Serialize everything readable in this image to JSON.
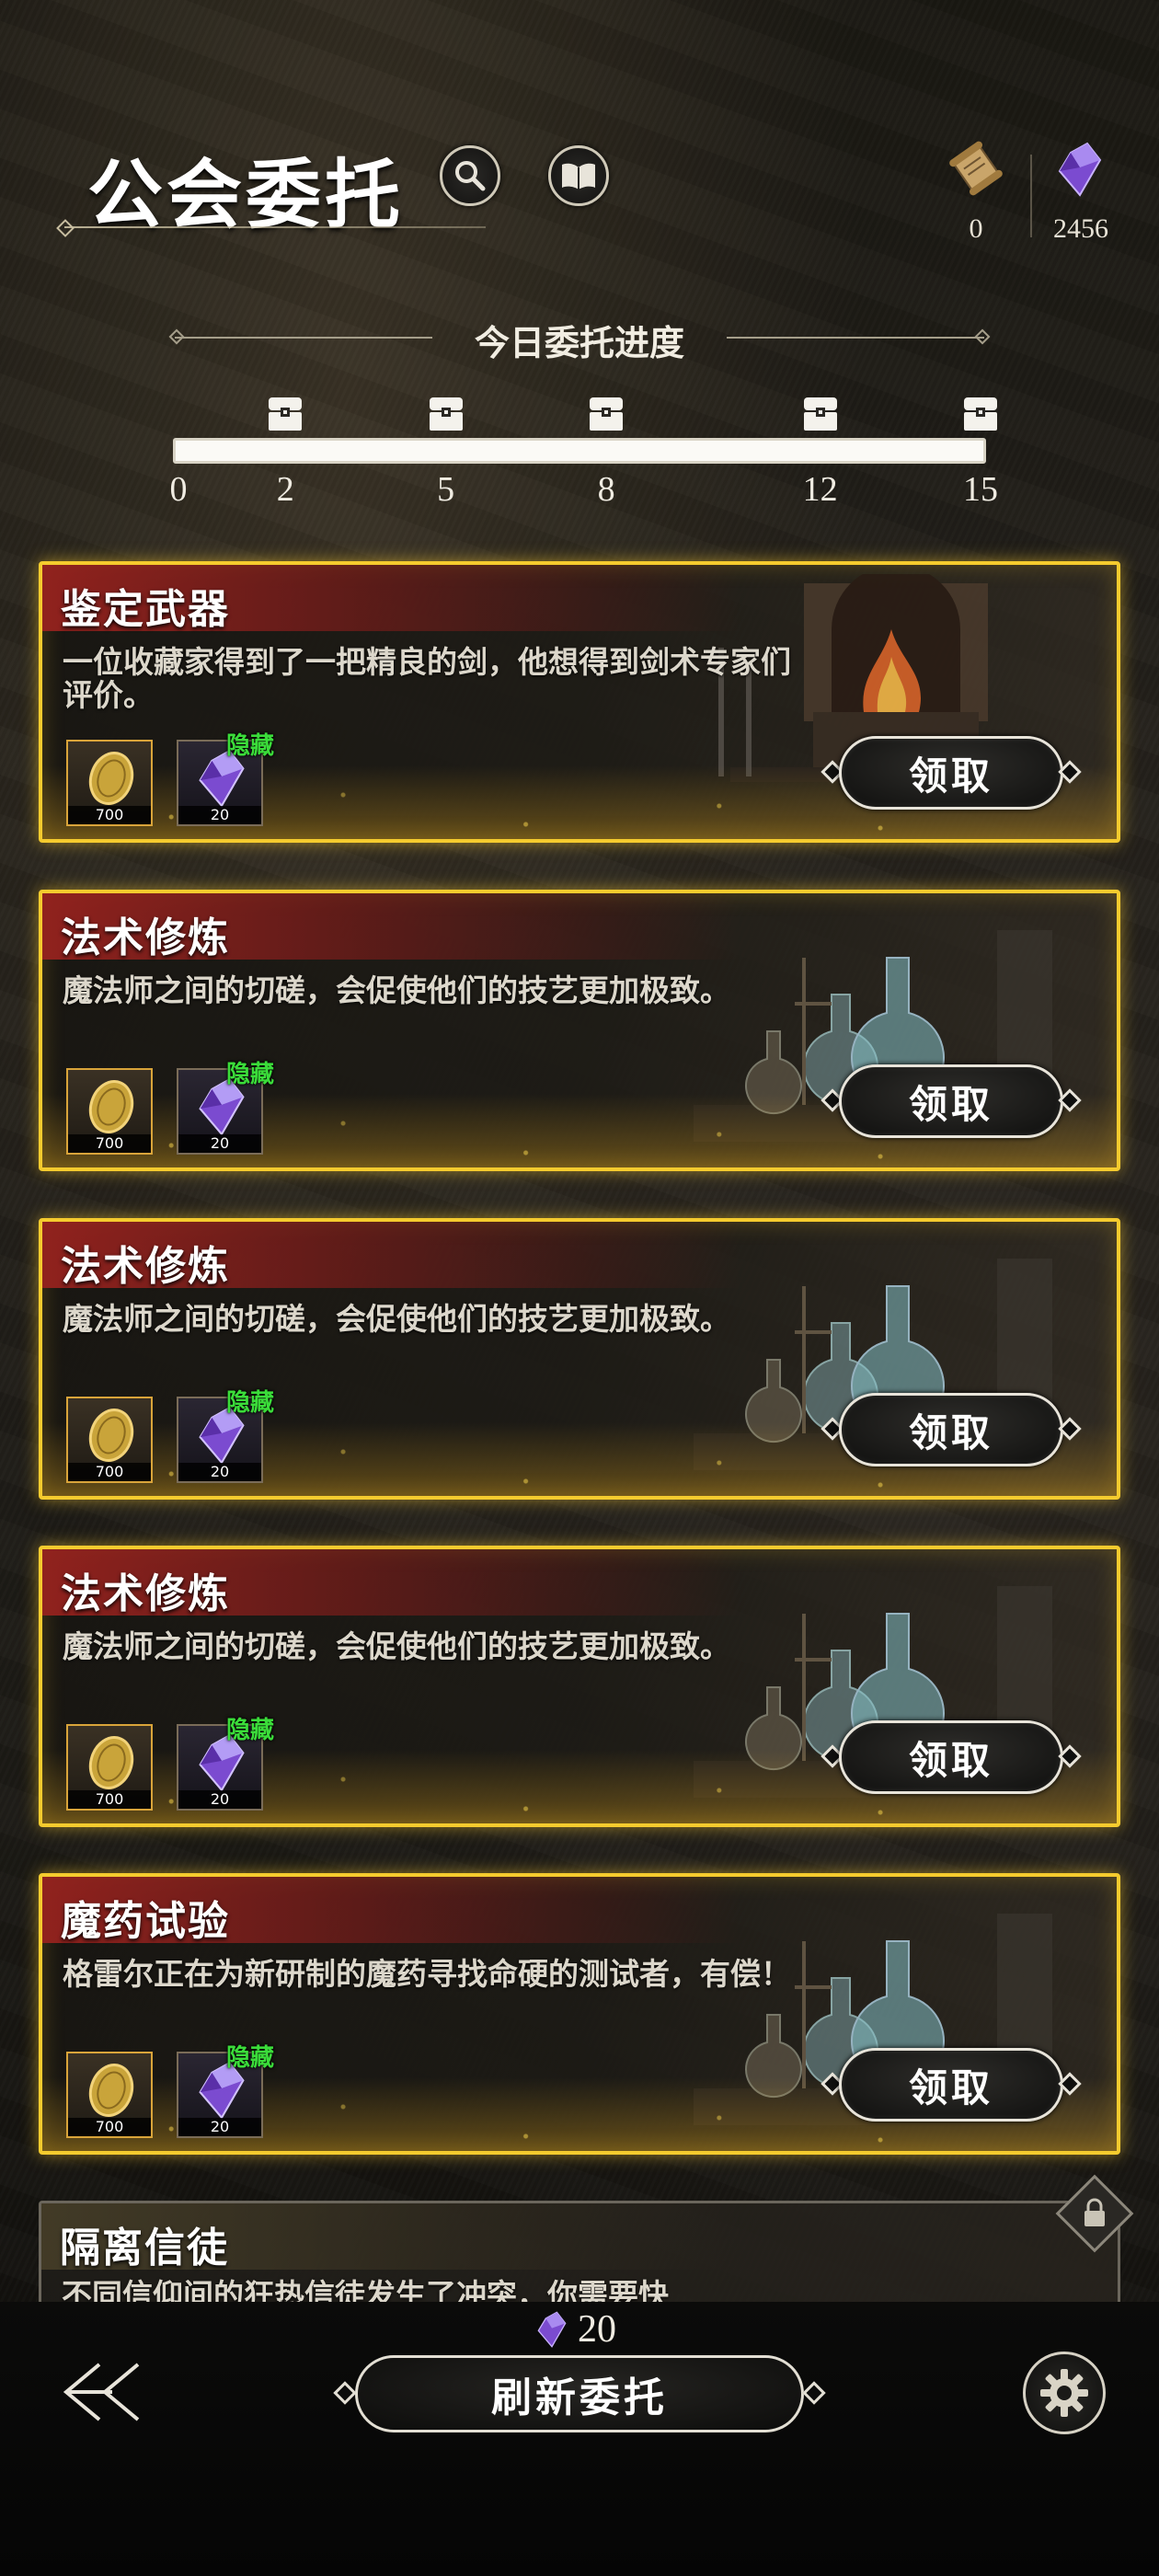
{
  "header": {
    "title": "公会委托",
    "search_icon": "magnifier-icon",
    "book_icon": "open-book-icon",
    "resources": [
      {
        "icon": "scroll-icon",
        "value": "0"
      },
      {
        "icon": "purple-crystal-icon",
        "value": "2456"
      }
    ]
  },
  "progress": {
    "title": "今日委托进度",
    "current": 15,
    "max": 15,
    "milestones": [
      {
        "label": "0",
        "value": 0,
        "chest": false
      },
      {
        "label": "2",
        "value": 2,
        "chest": true
      },
      {
        "label": "5",
        "value": 5,
        "chest": true
      },
      {
        "label": "8",
        "value": 8,
        "chest": true
      },
      {
        "label": "12",
        "value": 12,
        "chest": true
      },
      {
        "label": "15",
        "value": 15,
        "chest": true
      }
    ]
  },
  "quests": [
    {
      "title": "鉴定武器",
      "desc": "一位收藏家得到了一把精良的剑，他想得到剑术专家们评价。",
      "art": "forge",
      "rewards": [
        {
          "icon": "gold-coin-icon",
          "qty": "700"
        },
        {
          "icon": "purple-crystal-icon",
          "qty": "20",
          "tag": "隐藏"
        }
      ],
      "button": "领取"
    },
    {
      "title": "法术修炼",
      "desc": "魔法师之间的切磋，会促使他们的技艺更加极致。",
      "art": "alchemy",
      "rewards": [
        {
          "icon": "gold-coin-icon",
          "qty": "700"
        },
        {
          "icon": "purple-crystal-icon",
          "qty": "20",
          "tag": "隐藏"
        }
      ],
      "button": "领取"
    },
    {
      "title": "法术修炼",
      "desc": "魔法师之间的切磋，会促使他们的技艺更加极致。",
      "art": "alchemy",
      "rewards": [
        {
          "icon": "gold-coin-icon",
          "qty": "700"
        },
        {
          "icon": "purple-crystal-icon",
          "qty": "20",
          "tag": "隐藏"
        }
      ],
      "button": "领取"
    },
    {
      "title": "法术修炼",
      "desc": "魔法师之间的切磋，会促使他们的技艺更加极致。",
      "art": "alchemy",
      "rewards": [
        {
          "icon": "gold-coin-icon",
          "qty": "700"
        },
        {
          "icon": "purple-crystal-icon",
          "qty": "20",
          "tag": "隐藏"
        }
      ],
      "button": "领取"
    },
    {
      "title": "魔药试验",
      "desc": "格雷尔正在为新研制的魔药寻找命硬的测试者，有偿！",
      "art": "alchemy",
      "rewards": [
        {
          "icon": "gold-coin-icon",
          "qty": "700"
        },
        {
          "icon": "purple-crystal-icon",
          "qty": "20",
          "tag": "隐藏"
        }
      ],
      "button": "领取"
    }
  ],
  "locked_quest": {
    "title": "隔离信徒",
    "desc_partial": "不同信仰间的狂热信徒发生了冲突，你需要快",
    "icon": "lock-icon"
  },
  "footer": {
    "refresh_cost": "20",
    "refresh_cost_icon": "purple-crystal-icon",
    "refresh_label": "刷新委托",
    "back_icon": "back-arrow-icon",
    "settings_icon": "gear-icon"
  },
  "colors": {
    "gold_border": "#f5cb2e",
    "title_red": "#961e1a",
    "hidden_green": "#3bdc3a"
  }
}
